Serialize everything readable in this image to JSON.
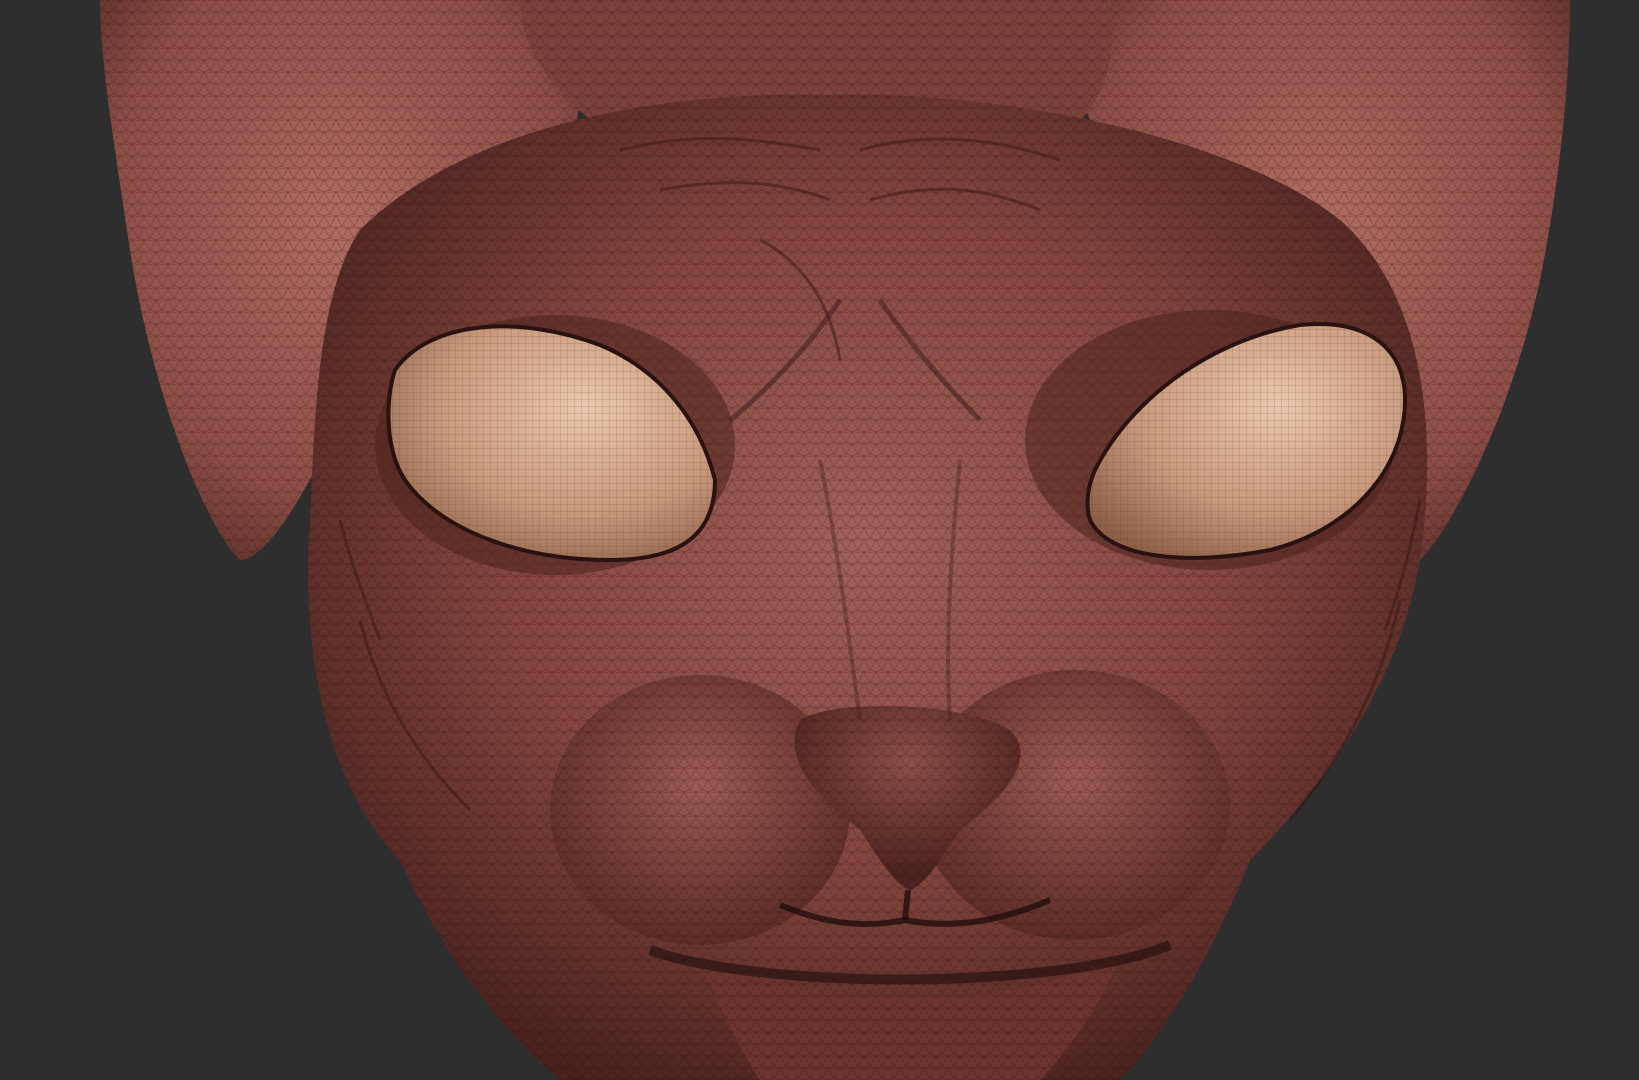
{
  "app": {
    "viewport_background": "#2e2e2e"
  },
  "model": {
    "subject": "sculpted-hairless-cat-head",
    "display_mode": "wireframe-over-shaded",
    "skin_color": "#8a4a42",
    "skin_highlight": "#b0685d",
    "skin_shadow": "#3a1a17",
    "eye_color": "#c99a7e",
    "eye_highlight": "#e4bda2",
    "wire_color": "#1e0c0a"
  }
}
